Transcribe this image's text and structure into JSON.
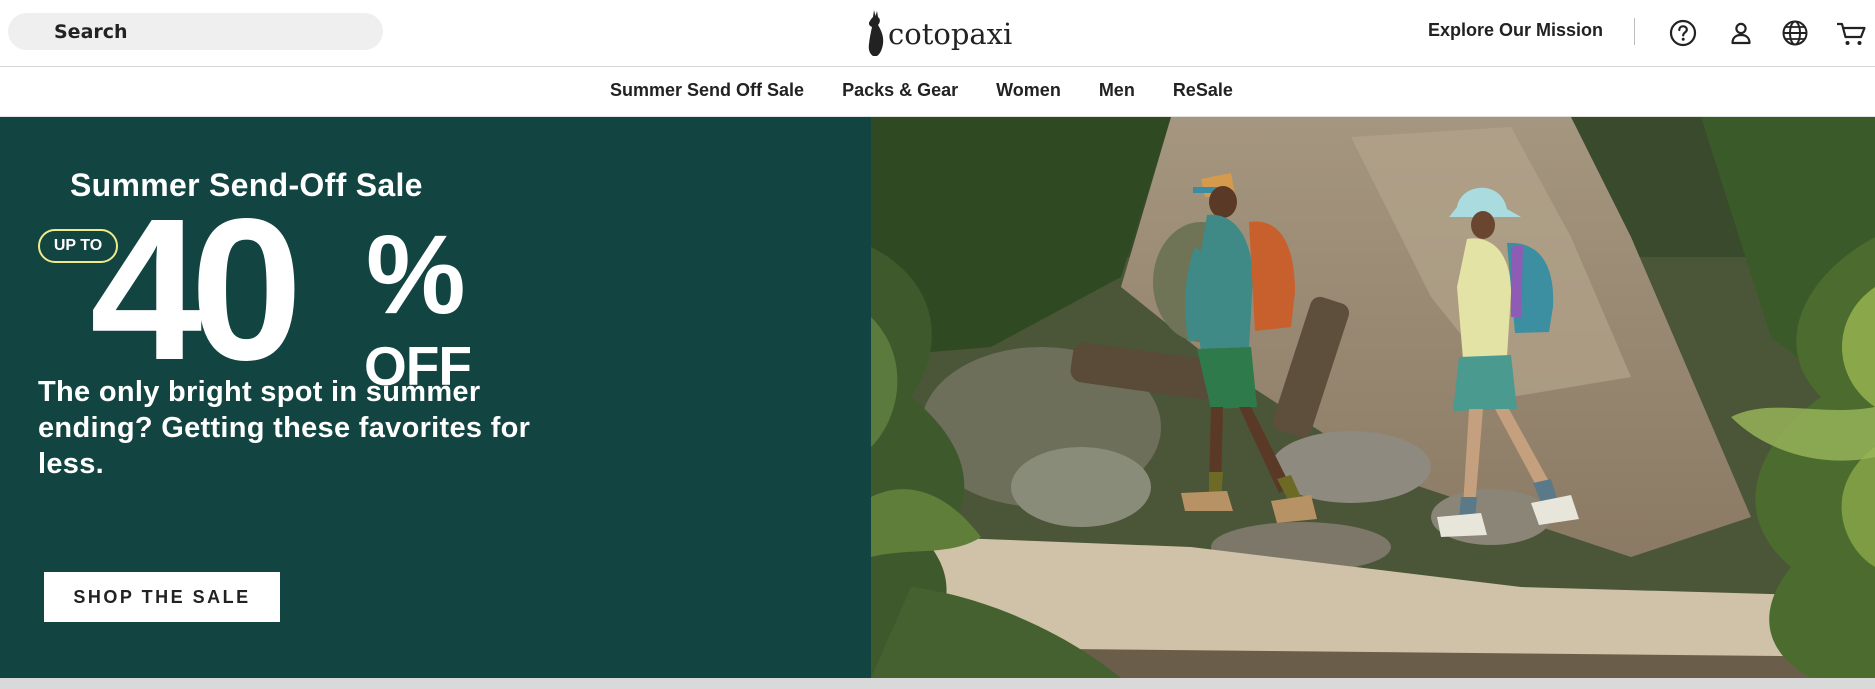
{
  "header": {
    "search_placeholder": "Search",
    "logo_text": "cotopaxi",
    "mission_link": "Explore Our Mission",
    "icons": [
      "help-icon",
      "account-icon",
      "globe-icon",
      "cart-icon"
    ]
  },
  "nav": {
    "items": [
      "Summer Send Off Sale",
      "Packs & Gear",
      "Women",
      "Men",
      "ReSale"
    ]
  },
  "hero": {
    "title": "Summer Send-Off Sale",
    "badge": "UP TO",
    "number": "40",
    "percent": "%",
    "off": "OFF",
    "tagline": "The only bright spot in summer ending? Getting these favorites for less.",
    "cta": "SHOP THE SALE",
    "image_alt": "Two hikers walking on a forest trail"
  },
  "colors": {
    "hero_bg": "#124541",
    "badge_outline": "#f0ea8a",
    "text": "#222222"
  }
}
